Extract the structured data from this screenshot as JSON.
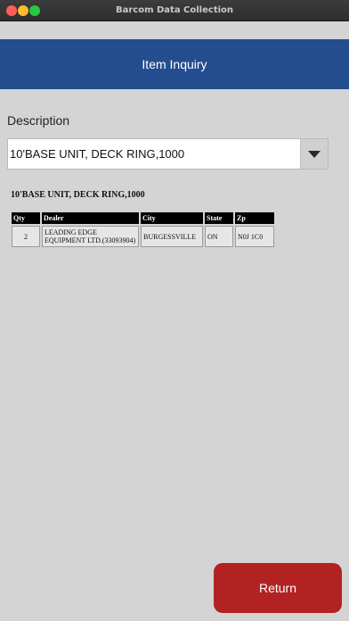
{
  "window": {
    "title": "Barcom Data Collection"
  },
  "header": {
    "title": "Item Inquiry"
  },
  "form": {
    "description_label": "Description",
    "description_value": "10'BASE UNIT, DECK RING,1000"
  },
  "result": {
    "item_title": "10'BASE UNIT, DECK RING,1000",
    "columns": [
      "Qty",
      "Dealer",
      "City",
      "State",
      "Zp"
    ],
    "rows": [
      {
        "qty": "2",
        "dealer": "LEADING EDGE EQUIPMENT LTD.(33093904)",
        "city": "BURGESSVILLE",
        "state": "ON",
        "zip": "N0J 1C0"
      }
    ]
  },
  "actions": {
    "return_label": "Return"
  },
  "colors": {
    "header_bg": "#244d8f",
    "return_bg": "#b22222",
    "page_bg": "#d4d4d4"
  },
  "icons": {
    "dropdown": "chevron-down-icon"
  }
}
